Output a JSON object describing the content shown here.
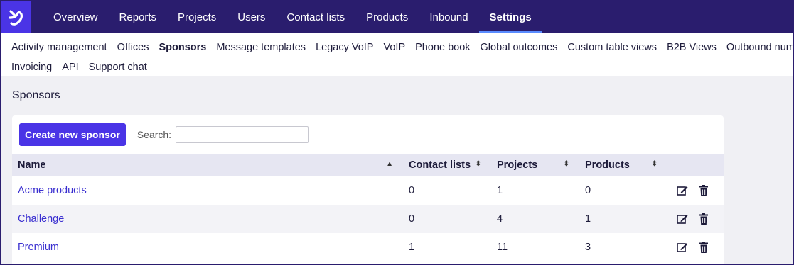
{
  "topnav": {
    "items": [
      "Overview",
      "Reports",
      "Projects",
      "Users",
      "Contact lists",
      "Products",
      "Inbound",
      "Settings"
    ],
    "active": "Settings"
  },
  "subnav": {
    "row1": [
      "Activity management",
      "Offices",
      "Sponsors",
      "Message templates",
      "Legacy VoIP",
      "VoIP",
      "Phone book",
      "Global outcomes",
      "Custom table views",
      "B2B Views",
      "Outbound numbers"
    ],
    "row2": [
      "Invoicing",
      "API",
      "Support chat"
    ],
    "active": "Sponsors"
  },
  "page": {
    "title": "Sponsors",
    "create_button": "Create new sponsor",
    "search_label": "Search:",
    "search_value": ""
  },
  "table": {
    "headers": [
      "Name",
      "Contact lists",
      "Projects",
      "Products"
    ],
    "rows": [
      {
        "name": "Acme products",
        "contact_lists": "0",
        "projects": "1",
        "products": "0"
      },
      {
        "name": "Challenge",
        "contact_lists": "0",
        "projects": "4",
        "products": "1"
      },
      {
        "name": "Premium",
        "contact_lists": "1",
        "projects": "11",
        "products": "3"
      }
    ]
  },
  "colors": {
    "brand": "#4a34e6",
    "topbar": "#2a1d6e",
    "link": "#3a2fd0"
  }
}
